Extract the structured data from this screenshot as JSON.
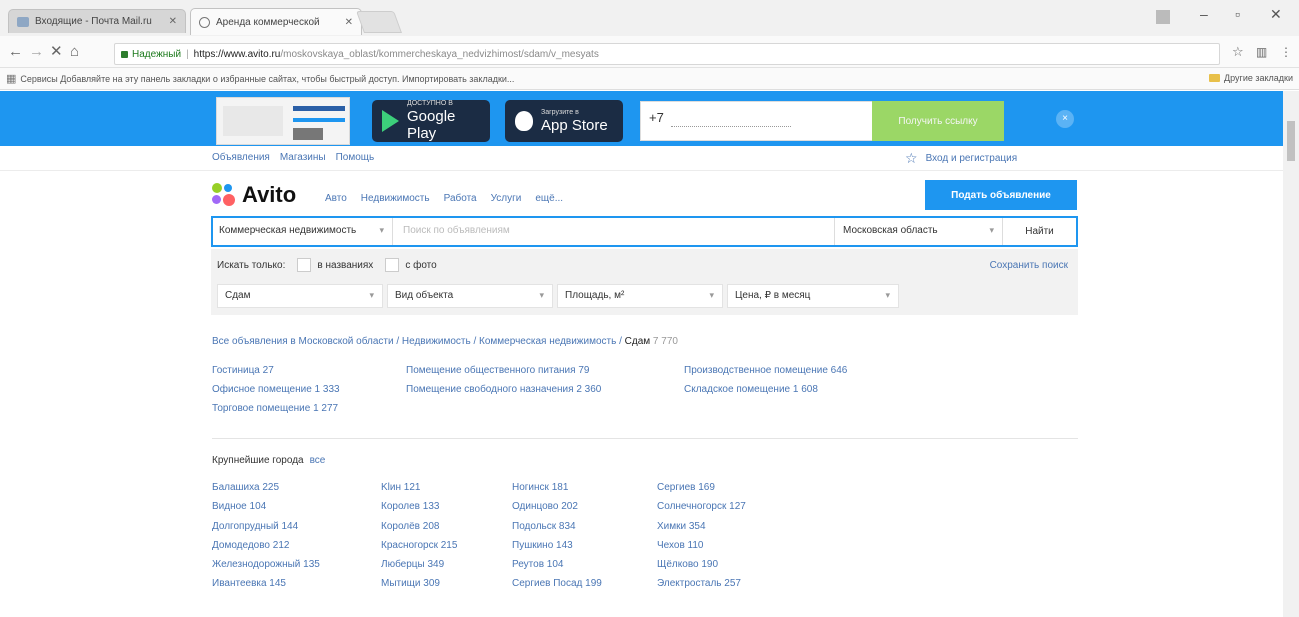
{
  "browser": {
    "tabs": [
      {
        "title": "Входящие - Почта Mail.ru",
        "active": false
      },
      {
        "title": "Аренда коммерческой",
        "active": true
      }
    ],
    "address": {
      "secure_label": "Надежный",
      "host": "https://www.avito.ru",
      "path": "/moskovskaya_oblast/kommercheskaya_nedvizhimost/sdam/v_mesyats"
    },
    "bookmarks_text": "Сервисы   Добавляйте на эту панель закладки о избранные сайтах, чтобы быстрый доступ. Импортировать закладки...",
    "other_bookmarks": "Другие закладки"
  },
  "banner": {
    "google_play_small": "ДОСТУПНО В",
    "google_play_big": "Google Play",
    "app_store_small": "Загрузите в",
    "app_store_big": "App Store",
    "phone_prefix": "+7",
    "send_button": "Получить ссылку",
    "close": "×"
  },
  "topnav": {
    "items": [
      "Объявления",
      "Магазины",
      "Помощь"
    ],
    "login": "Вход и регистрация"
  },
  "logo": "Avito",
  "category_nav": [
    "Авто",
    "Недвижимость",
    "Работа",
    "Услуги",
    "ещё..."
  ],
  "post_ad_button": "Подать объявление",
  "search": {
    "category": "Коммерческая недвижимость",
    "placeholder": "Поиск по объявлениям",
    "region": "Московская область",
    "find_button": "Найти"
  },
  "filters": {
    "search_only": "Искать только:",
    "in_titles": "в названиях",
    "with_photo": "с фото",
    "save_search": "Сохранить поиск",
    "selects": [
      "Сдам",
      "Вид объекта",
      "Площадь, м²",
      "Цена, ₽ в месяц"
    ]
  },
  "breadcrumb": {
    "path": "Все объявления в Московской области / Недвижимость / Коммерческая недвижимость / ",
    "current": "Сдам",
    "count": " 7 770"
  },
  "categories": [
    [
      "Гостиница 27",
      "Офисное помещение 1 333",
      "Торговое помещение 1 277"
    ],
    [
      "Помещение общественного питания 79",
      "Помещение свободного назначения 2 360"
    ],
    [
      "Производственное помещение 646",
      "Складское помещение 1 608"
    ]
  ],
  "cities_title": "Крупнейшие города",
  "cities_all": "все",
  "cities": [
    [
      "Балашиха 225",
      "Видное 104",
      "Долгопрудный 144",
      "Домодедово 212",
      "Железнодорожный 135",
      "Ивантеевка 145"
    ],
    [
      "Klин 121",
      "Королев 133",
      "Королёв 208",
      "Красногорск 215",
      "Люберцы 349",
      "Мытищи 309"
    ],
    [
      "Ногинск 181",
      "Одинцово 202",
      "Подольск 834",
      "Пушкино 143",
      "Реутов 104",
      "Сергиев Посад 199"
    ],
    [
      "Сергиев 169",
      "Солнечногорск 127",
      "Химки 354",
      "Чехов 110",
      "Щёлково 190",
      "Электросталь 257"
    ]
  ],
  "colors": {
    "accent": "#1e96f0",
    "link": "#4a76b4",
    "send_button": "#9bd766"
  }
}
